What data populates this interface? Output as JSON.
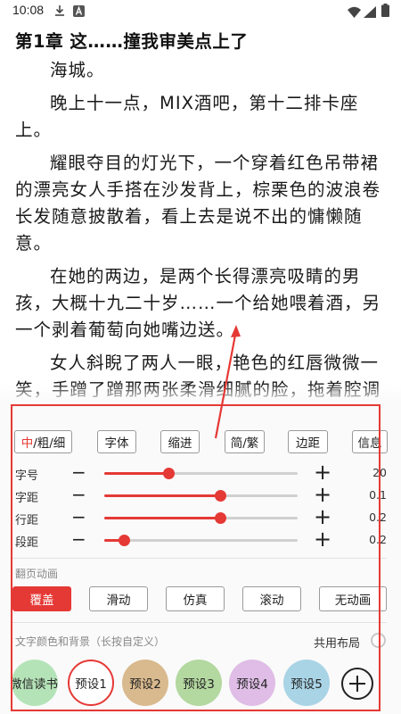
{
  "status_bar": {
    "time": "10:08",
    "icons": [
      "download-icon",
      "a-badge-icon",
      "wifi-icon",
      "signal-icon",
      "battery-icon"
    ]
  },
  "reader": {
    "chapter_title": "第1章 这……撞我审美点上了",
    "paragraphs": [
      "海城。",
      "晚上十一点，MIX酒吧，第十二排卡座上。",
      "耀眼夺目的灯光下，一个穿着红色吊带裙的漂亮女人手搭在沙发背上，棕栗色的波浪卷长发随意披散着，看上去是说不出的慵懒随意。",
      "在她的两边，是两个长得漂亮吸睛的男孩，大概十九二十岁……一个给她喂着酒，另一个剥着葡萄向她嘴边送。",
      "女人斜睨了两人一眼，艳色的红唇微微一笑，手蹭了蹭那两张柔滑细腻的脸，拖着腔调道：“真乖。”"
    ]
  },
  "settings": {
    "top_buttons": {
      "weight": {
        "highlight": "中",
        "rest": "/粗/细"
      },
      "font": "字体",
      "indent": "缩进",
      "simp_trad": "简/繁",
      "margin": "边距",
      "info": "信息"
    },
    "sliders": [
      {
        "label": "字号",
        "value": "20",
        "level": 0.33
      },
      {
        "label": "字距",
        "value": "0.1",
        "level": 0.6
      },
      {
        "label": "行距",
        "value": "0.2",
        "level": 0.6
      },
      {
        "label": "段距",
        "value": "0.2",
        "level": 0.1
      }
    ],
    "page_anim": {
      "label": "翻页动画",
      "options": [
        "覆盖",
        "滑动",
        "仿真",
        "滚动",
        "无动画"
      ],
      "selected": "覆盖"
    },
    "color_bg": {
      "label": "文字颜色和背景（长按自定义）",
      "shared_layout": "共用布局",
      "presets": [
        {
          "label": "微信读书",
          "color": "#b5e3b8"
        },
        {
          "label": "预设1",
          "color": "#ffffff"
        },
        {
          "label": "预设2",
          "color": "#d9b98e"
        },
        {
          "label": "预设3",
          "color": "#b3d8a0"
        },
        {
          "label": "预设4",
          "color": "#dfbde6"
        },
        {
          "label": "预设5",
          "color": "#a9d4e6"
        }
      ],
      "selected_preset": "预设1"
    },
    "accent_color": "#e53935"
  }
}
